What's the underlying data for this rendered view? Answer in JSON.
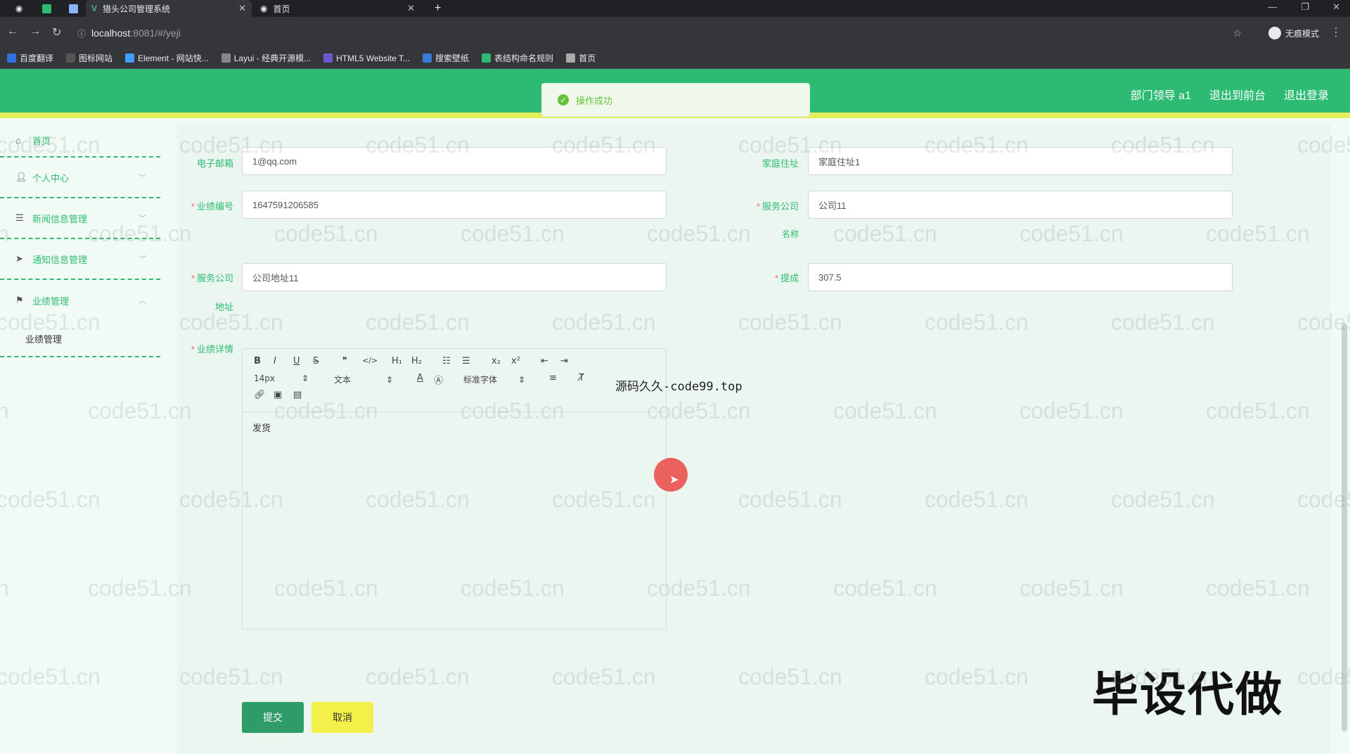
{
  "browser": {
    "tabs": [
      {
        "label": "猎头公司管理系统",
        "active": true
      },
      {
        "label": "首页",
        "active": false
      }
    ],
    "url_host": "localhost",
    "url_path": ":8081/#/yeji",
    "incognito": "无痕模式",
    "bookmarks": [
      {
        "label": "百度翻译",
        "color": "#2f6fe0"
      },
      {
        "label": "图标网站",
        "color": "#555555"
      },
      {
        "label": "Element - 网站快...",
        "color": "#409eff"
      },
      {
        "label": "Layui - 经典开源模...",
        "color": "#888888"
      },
      {
        "label": "HTML5 Website T...",
        "color": "#6a5acd"
      },
      {
        "label": "搜索壁纸",
        "color": "#3a7bd5"
      },
      {
        "label": "表结构命名规则",
        "color": "#2dbb73"
      },
      {
        "label": "首页",
        "color": "#aaaaaa"
      }
    ]
  },
  "header": {
    "user": "部门领导 a1",
    "to_front": "退出到前台",
    "logout": "退出登录",
    "toast": "操作成功"
  },
  "sidebar": {
    "items": [
      {
        "label": "首页",
        "icon": "home-icon"
      },
      {
        "label": "个人中心",
        "icon": "user-icon"
      },
      {
        "label": "新闻信息管理",
        "icon": "sliders-icon"
      },
      {
        "label": "通知信息管理",
        "icon": "send-icon"
      },
      {
        "label": "业绩管理",
        "icon": "flag-icon"
      }
    ],
    "sub_item": "业绩管理"
  },
  "form": {
    "email_label": "电子邮箱",
    "email_value": "1@qq.com",
    "address_label": "家庭住址",
    "address_value": "家庭住址1",
    "perf_no_label": "业绩编号",
    "perf_no_value": "1647591206585",
    "company_name_label_1": "服务公司",
    "company_name_label_2": "名称",
    "company_name_value": "公司11",
    "company_addr_label_1": "服务公司",
    "company_addr_label_2": "地址",
    "company_addr_value": "公司地址11",
    "commission_label": "提成",
    "commission_value": "307.5",
    "detail_label": "业绩详情",
    "editor_font_size": "14px",
    "editor_text_type": "文本",
    "editor_font_family": "标准字体",
    "editor_content": "发货",
    "submit": "提交",
    "cancel": "取消"
  },
  "overlay": {
    "source_note": "源码久久-code99.top",
    "promo": "毕设代做",
    "watermark": "code51.cn"
  }
}
